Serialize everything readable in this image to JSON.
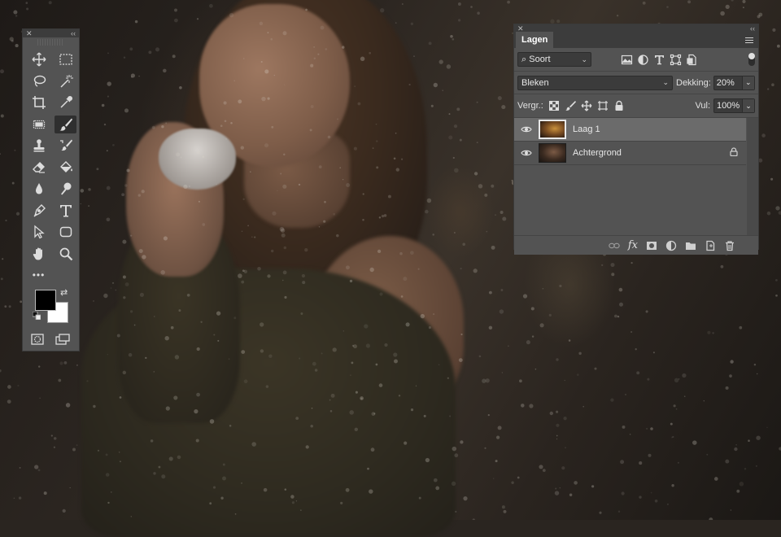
{
  "tools_panel": {
    "tools": [
      {
        "left": "move-icon",
        "right": "marquee-icon"
      },
      {
        "left": "lasso-icon",
        "right": "magic-wand-icon"
      },
      {
        "left": "crop-icon",
        "right": "eyedropper-icon"
      },
      {
        "left": "healing-icon",
        "right": "brush-icon"
      },
      {
        "left": "stamp-icon",
        "right": "history-brush-icon"
      },
      {
        "left": "eraser-icon",
        "right": "bucket-icon"
      },
      {
        "left": "blur-icon",
        "right": "dodge-icon"
      },
      {
        "left": "pen-icon",
        "right": "type-icon"
      },
      {
        "left": "path-select-icon",
        "right": "shape-icon"
      },
      {
        "left": "hand-icon",
        "right": "zoom-icon"
      }
    ],
    "active_tool": "brush-icon",
    "more_label": "•••",
    "foreground_color": "#000000",
    "background_color": "#ffffff"
  },
  "layers_panel": {
    "tab_label": "Lagen",
    "filter": {
      "label": "Soort"
    },
    "blend_mode": "Bleken",
    "opacity_label": "Dekking:",
    "opacity_value": "20%",
    "lock_label": "Vergr.:",
    "fill_label": "Vul:",
    "fill_value": "100%",
    "layers": [
      {
        "name": "Laag 1",
        "selected": true,
        "visible": true,
        "locked": false
      },
      {
        "name": "Achtergrond",
        "selected": false,
        "visible": true,
        "locked": true
      }
    ],
    "footer_fx": "fx"
  },
  "colors": {
    "panel_bg": "#535353",
    "panel_dark": "#3c3c3c",
    "selected_layer": "#6b6b6b"
  }
}
